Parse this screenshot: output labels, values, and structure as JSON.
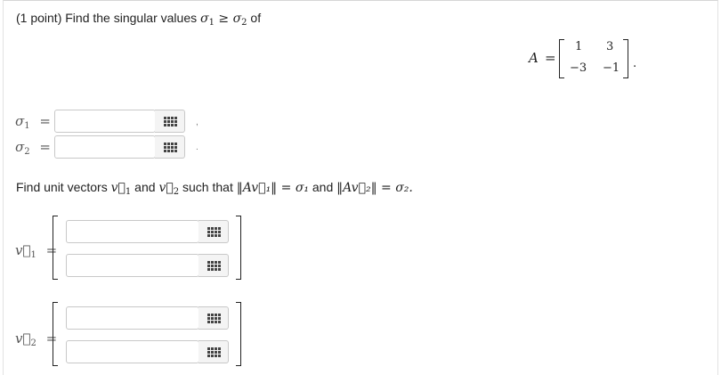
{
  "question": {
    "prefix": "(1 point) Find the singular values ",
    "sigma_symbol": "σ",
    "sub1": "1",
    "sub2": "2",
    "geq": " ≥ ",
    "suffix": " of"
  },
  "matrix": {
    "label": "A",
    "equals": "=",
    "cells": [
      "1",
      "3",
      "−3",
      "−1"
    ],
    "trailing": "."
  },
  "sigma_answers": {
    "sigma1": {
      "symbol": "σ",
      "sub": "1",
      "equals": "=",
      "value": "",
      "after": ","
    },
    "sigma2": {
      "symbol": "σ",
      "sub": "2",
      "equals": "=",
      "value": "",
      "after": "."
    }
  },
  "vectors_question": {
    "prefix": "Find unit vectors ",
    "v1": "v⃗",
    "and": " and ",
    "v2": "v⃗",
    "such_that": " such that ",
    "norm1": "‖Av⃗₁‖",
    "eq1": " = σ₁",
    "and2": " and ",
    "norm2": "‖Av⃗₂‖",
    "eq2": " = σ₂."
  },
  "vector_answers": {
    "v1": {
      "symbol": "v⃗",
      "sub": "1",
      "equals": "=",
      "entries": [
        "",
        ""
      ]
    },
    "v2": {
      "symbol": "v⃗",
      "sub": "2",
      "equals": "=",
      "entries": [
        "",
        ""
      ]
    }
  },
  "colors": {
    "border": "#c8c8c8",
    "button_bg": "#f4f4f4",
    "text": "#222222"
  },
  "icons": {
    "calc_button": "calculator-grid-icon"
  }
}
